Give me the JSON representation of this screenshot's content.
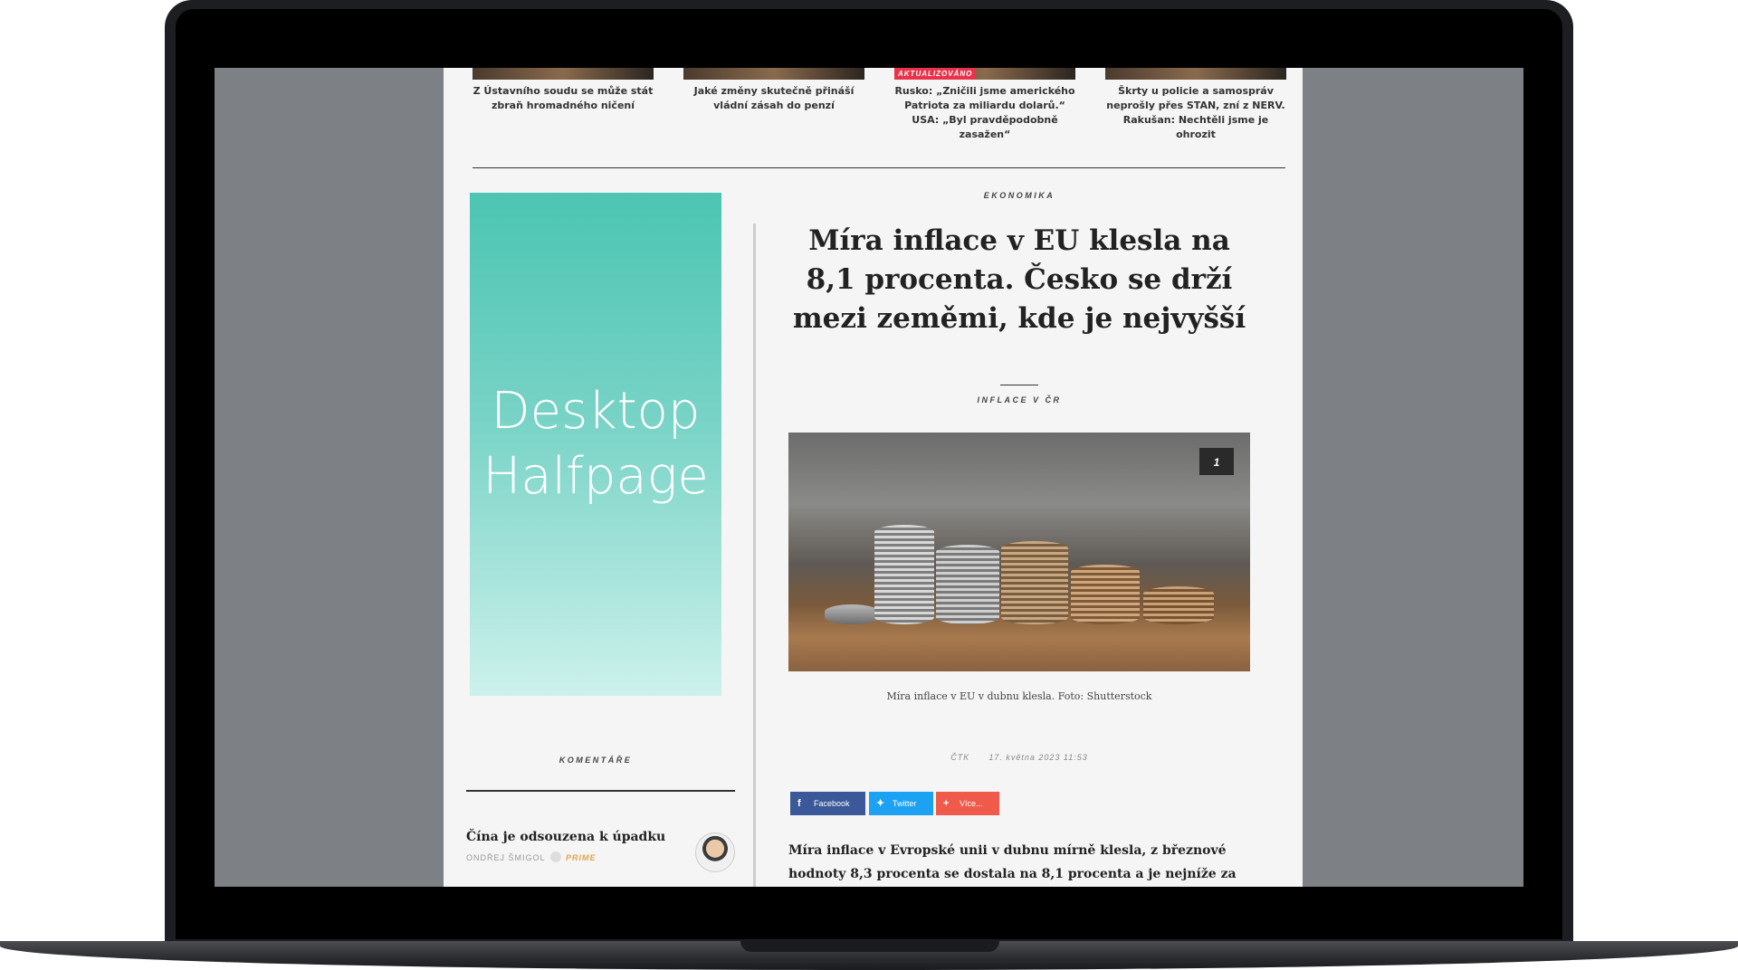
{
  "top_stories": [
    {
      "title": "Z Ústavního soudu se může stát zbraň hromadného ničení",
      "tag": ""
    },
    {
      "title": "Jaké změny skutečně přináší vládní zásah do penzí",
      "tag": ""
    },
    {
      "title": "Rusko: „Zničili jsme amerického Patriota za miliardu dolarů.“ USA: „Byl pravděpodobně zasažen“",
      "tag": "AKTUALIZOVÁNO"
    },
    {
      "title": "Škrty u policie a samospráv neprošly přes STAN, zní z NERV. Rakušan: Nechtěli jsme je ohrozit",
      "tag": ""
    }
  ],
  "ad": {
    "line1": "Desktop",
    "line2": "Halfpage"
  },
  "article": {
    "section": "EKONOMIKA",
    "headline": "Míra inflace v EU klesla na 8,1 procenta. Česko se drží mezi zeměmi, kde je nejvyšší",
    "topic": "INFLACE V ČR",
    "photo_count": "1",
    "caption": "Míra inflace v EU v dubnu klesla. Foto: Shutterstock",
    "source": "ČTK",
    "date": "17. května 2023 11:53",
    "lead": "Míra inflace v Evropské unii v dubnu mírně klesla, z březnové hodnoty 8,3 procenta se dostala na 8,1 procenta a je nejníže za poslední rok."
  },
  "share": {
    "facebook": "Facebook",
    "twitter": "Twitter",
    "more": "Více...",
    "colors": {
      "facebook": "#3b5998",
      "twitter": "#1da1f2",
      "more": "#f05a4a"
    }
  },
  "comments": {
    "label": "KOMENTÁŘE",
    "items": [
      {
        "title": "Čína je odsouzena k úpadku",
        "author": "ONDŘEJ ŠMIGOL",
        "badge": "PRIME"
      }
    ]
  }
}
